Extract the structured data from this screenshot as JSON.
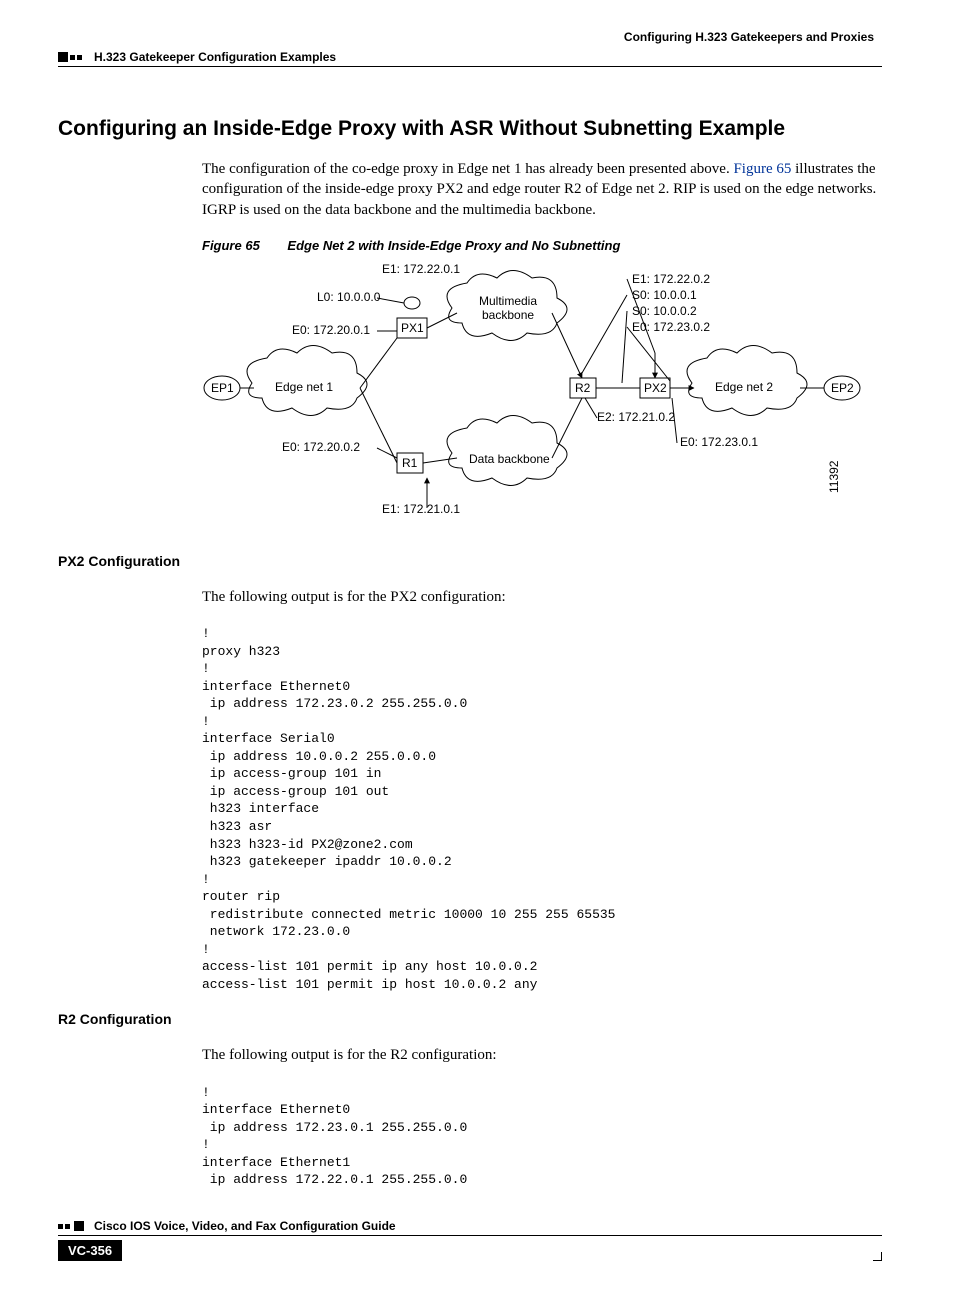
{
  "header": {
    "right": "Configuring H.323 Gatekeepers and Proxies",
    "left": "H.323 Gatekeeper Configuration Examples"
  },
  "section": {
    "title": "Configuring an Inside-Edge Proxy with ASR Without Subnetting Example",
    "intro_part1": "The configuration of the co-edge proxy in Edge net 1 has already been presented above. ",
    "intro_link": "Figure 65",
    "intro_part2": " illustrates the configuration of the inside-edge proxy PX2 and edge router R2 of Edge net 2. RIP is used on the edge networks. IGRP is used on the data backbone and the multimedia backbone."
  },
  "figure": {
    "number": "Figure 65",
    "title": "Edge Net 2 with Inside-Edge Proxy and No Subnetting",
    "id_label": "11392",
    "labels": {
      "e1_px1": "E1:  172.22.0.1",
      "l0_px1": "L0:  10.0.0.0",
      "e0_px1": "E0:  172.20.0.1",
      "px1": "PX1",
      "mm_backbone": "Multimedia backbone",
      "e1_r2": "E1:  172.22.0.2",
      "s0_r2": "S0:  10.0.0.1",
      "s0_px2": "S0:  10.0.0.2",
      "e0_px2": "E0:  172.23.0.2",
      "px2": "PX2",
      "r2": "R2",
      "edge_net_2": "Edge net 2",
      "ep2": "EP2",
      "ep1": "EP1",
      "edge_net_1": "Edge net 1",
      "e2_r2": "E2:  172.21.0.2",
      "e0_r1": "E0:  172.20.0.2",
      "r1": "R1",
      "data_backbone": "Data backbone",
      "e0_px2b": "E0:  172.23.0.1",
      "e1_r1": "E1:  172.21.0.1"
    }
  },
  "px2": {
    "heading": "PX2 Configuration",
    "intro": "The following output is for the PX2 configuration:",
    "code": "!\nproxy h323\n!\ninterface Ethernet0\n ip address 172.23.0.2 255.255.0.0\n!\ninterface Serial0\n ip address 10.0.0.2 255.0.0.0\n ip access-group 101 in\n ip access-group 101 out\n h323 interface\n h323 asr\n h323 h323-id PX2@zone2.com\n h323 gatekeeper ipaddr 10.0.0.2\n!\nrouter rip\n redistribute connected metric 10000 10 255 255 65535\n network 172.23.0.0\n!\naccess-list 101 permit ip any host 10.0.0.2\naccess-list 101 permit ip host 10.0.0.2 any"
  },
  "r2": {
    "heading": "R2 Configuration",
    "intro": "The following output is for the R2 configuration:",
    "code": "!\ninterface Ethernet0\n ip address 172.23.0.1 255.255.0.0\n!\ninterface Ethernet1\n ip address 172.22.0.1 255.255.0.0"
  },
  "footer": {
    "guide": "Cisco IOS Voice, Video, and Fax Configuration Guide",
    "page": "VC-356"
  }
}
